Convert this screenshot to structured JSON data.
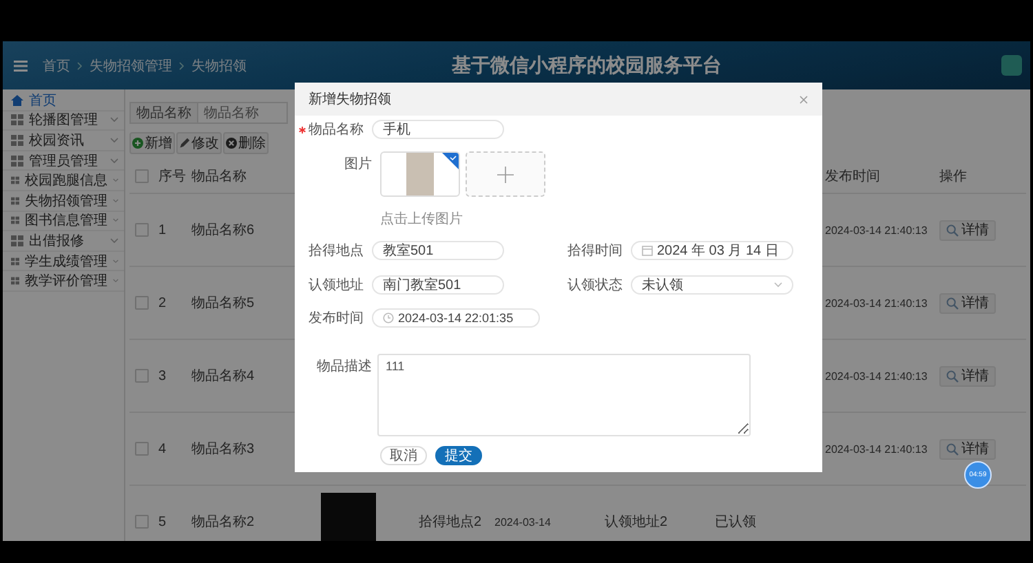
{
  "header": {
    "breadcrumb": [
      "首页",
      "失物招领管理",
      "失物招领"
    ],
    "title": "基于微信小程序的校园服务平台"
  },
  "sidebar": {
    "items": [
      {
        "label": "首页",
        "kind": "home",
        "selected": true
      },
      {
        "label": "轮播图管理",
        "kind": "menu",
        "selected": false
      },
      {
        "label": "校园资讯",
        "kind": "menu",
        "selected": false
      },
      {
        "label": "管理员管理",
        "kind": "menu",
        "selected": false
      },
      {
        "label": "校园跑腿信息",
        "kind": "menu",
        "selected": false
      },
      {
        "label": "失物招领管理",
        "kind": "menu",
        "selected": false
      },
      {
        "label": "图书信息管理",
        "kind": "menu",
        "selected": false
      },
      {
        "label": "出借报修",
        "kind": "menu",
        "selected": false
      },
      {
        "label": "学生成绩管理",
        "kind": "menu",
        "selected": false
      },
      {
        "label": "教学评价管理",
        "kind": "menu",
        "selected": false
      }
    ]
  },
  "search": {
    "label": "物品名称",
    "placeholder": "物品名称"
  },
  "toolbar": [
    {
      "label": "新增",
      "kind": "add"
    },
    {
      "label": "修改",
      "kind": "edit"
    },
    {
      "label": "删除",
      "kind": "delete"
    }
  ],
  "table": {
    "checked": false,
    "headers": {
      "index": "序号",
      "name": "物品名称",
      "published": "发布时间",
      "action": "操作"
    },
    "rows": [
      {
        "checked": false,
        "index": "1",
        "name": "物品名称6",
        "published": "2024-03-14 21:40:13",
        "action": "详情"
      },
      {
        "checked": false,
        "index": "2",
        "name": "物品名称5",
        "published": "2024-03-14 21:40:13",
        "action": "详情"
      },
      {
        "checked": false,
        "index": "3",
        "name": "物品名称4",
        "published": "2024-03-14 21:40:13",
        "action": "详情"
      },
      {
        "checked": false,
        "index": "4",
        "name": "物品名称3",
        "published": "2024-03-14 21:40:13",
        "action": "详情"
      },
      {
        "checked": false,
        "index": "5",
        "name": "物品名称2",
        "photo": true,
        "found_place": "拾得地点2",
        "found_date": "2024-03-14",
        "claim_place": "认领地址2",
        "claim_status": "已认领"
      }
    ]
  },
  "dialog": {
    "title": "新增失物招领",
    "name": {
      "label": "物品名称",
      "value": "手机",
      "required": true
    },
    "image": {
      "label": "图片",
      "uploaded": true,
      "hint": "点击上传图片"
    },
    "found_place": {
      "label": "拾得地点",
      "value": "教室501"
    },
    "found_time": {
      "label": "拾得时间",
      "value": "2024 年 03 月 14 日"
    },
    "claim_place": {
      "label": "认领地址",
      "value": "南门教室501"
    },
    "claim_status": {
      "label": "认领状态",
      "value": "未认领"
    },
    "published": {
      "label": "发布时间",
      "value": "2024-03-14 22:01:35"
    },
    "description": {
      "label": "物品描述",
      "value": "111"
    },
    "buttons": [
      {
        "label": "取消",
        "kind": "cancel"
      },
      {
        "label": "提交",
        "kind": "primary"
      }
    ]
  },
  "timer": "04:59"
}
